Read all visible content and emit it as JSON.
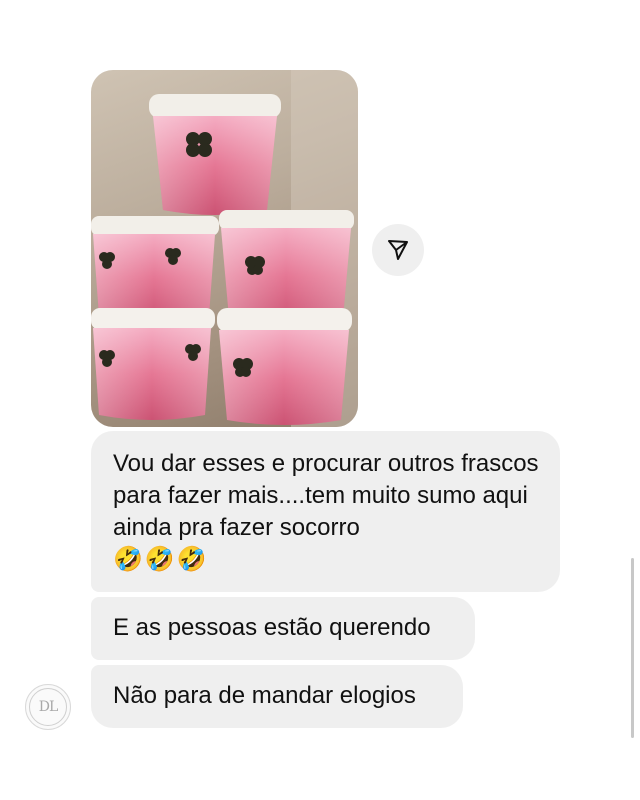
{
  "chat": {
    "share_icon": "paper-plane-icon",
    "photo_icon": "photo-stacked-jars-with-pink-wax-and-clover-leaves",
    "avatar_icon": "dl-monogram-avatar",
    "avatar_text": "DL",
    "messages": [
      {
        "text": "Vou dar esses e procurar outros frascos para fazer mais....tem muito sumo aqui ainda pra fazer socorro",
        "emojis": "🤣🤣🤣"
      },
      {
        "text": "E as pessoas estão querendo"
      },
      {
        "text": "Não para de mandar elogios"
      }
    ]
  },
  "colors": {
    "background": "#ffffff",
    "bubble": "#efefef",
    "text": "#111111"
  }
}
